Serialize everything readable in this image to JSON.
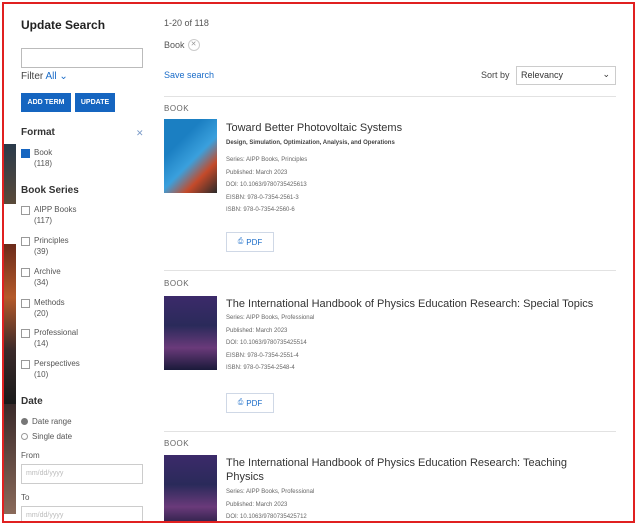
{
  "sidebar": {
    "heading": "Update Search",
    "search_value": "",
    "filter_label": "Filter",
    "filter_value": "All",
    "add_term_label": "ADD TERM",
    "update_label": "UPDATE",
    "format": {
      "title": "Format",
      "items": [
        {
          "label": "Book",
          "count": "(118)",
          "checked": true
        }
      ]
    },
    "book_series": {
      "title": "Book Series",
      "items": [
        {
          "label": "AIPP Books",
          "count": "(117)"
        },
        {
          "label": "Principles",
          "count": "(39)"
        },
        {
          "label": "Archive",
          "count": "(34)"
        },
        {
          "label": "Methods",
          "count": "(20)"
        },
        {
          "label": "Professional",
          "count": "(14)"
        },
        {
          "label": "Perspectives",
          "count": "(10)"
        }
      ]
    },
    "date": {
      "title": "Date",
      "option_range": "Date range",
      "option_single": "Single date",
      "from_label": "From",
      "from_placeholder": "mm/dd/yyyy",
      "to_label": "To",
      "to_placeholder": "mm/dd/yyyy"
    }
  },
  "results": {
    "count_text": "1-20 of 118",
    "active_filter": "Book",
    "save_search": "Save search",
    "sort_label": "Sort by",
    "sort_value": "Relevancy",
    "items": [
      {
        "type": "BOOK",
        "title": "Toward Better Photovoltaic Systems",
        "subtitle": "Design, Simulation, Optimization, Analysis, and Operations",
        "series": "Series: AIPP Books, Principles",
        "published": "Published: March 2023",
        "doi": "DOI: 10.1063/9780735425613",
        "eisbn": "EISBN: 978-0-7354-2561-3",
        "isbn": "ISBN: 978-0-7354-2560-6",
        "pdf_label": "PDF"
      },
      {
        "type": "BOOK",
        "title": "The International Handbook of Physics Education Research: Special Topics",
        "series": "Series: AIPP Books, Professional",
        "published": "Published: March 2023",
        "doi": "DOI: 10.1063/9780735425514",
        "eisbn": "EISBN: 978-0-7354-2551-4",
        "isbn": "ISBN: 978-0-7354-2548-4",
        "pdf_label": "PDF"
      },
      {
        "type": "BOOK",
        "title": "The International Handbook of Physics Education Research: Teaching Physics",
        "series": "Series: AIPP Books, Professional",
        "published": "Published: March 2023",
        "doi": "DOI: 10.1063/9780735425712"
      }
    ]
  },
  "colors": {
    "accent": "#1565c0",
    "link": "#1a6cc8",
    "frame": "#e02020"
  }
}
